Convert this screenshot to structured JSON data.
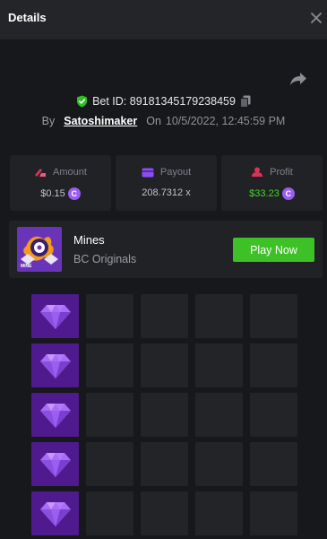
{
  "header": {
    "title": "Details"
  },
  "bet": {
    "id_text": "Bet ID: 89181345179238459",
    "by_label": "By",
    "username": "Satoshimaker",
    "on_label": "On",
    "timestamp": "10/5/2022, 12:45:59 PM"
  },
  "stats": {
    "amount": {
      "label": "Amount",
      "value": "$0.15"
    },
    "payout": {
      "label": "Payout",
      "value": "208.7312 x"
    },
    "profit": {
      "label": "Profit",
      "value": "$33.23"
    }
  },
  "game": {
    "name": "Mines",
    "provider": "BC Originals",
    "thumb_label": "MINE",
    "play_label": "Play Now"
  },
  "board": {
    "columns": 5,
    "rows": [
      [
        "gem",
        "hidden",
        "hidden",
        "hidden",
        "hidden"
      ],
      [
        "gem",
        "hidden",
        "hidden",
        "hidden",
        "hidden"
      ],
      [
        "gem",
        "hidden",
        "hidden",
        "hidden",
        "hidden"
      ],
      [
        "gem",
        "hidden",
        "hidden",
        "hidden",
        "hidden"
      ],
      [
        "gem",
        "hidden",
        "hidden",
        "hidden",
        "hidden"
      ]
    ]
  },
  "colors": {
    "background": "#17181b",
    "header": "#232529",
    "card": "#202226",
    "accent_green": "#3ec126",
    "profit_green": "#48d32a",
    "gem_tile": "#4f1a8e",
    "coin": "#9b5cf2"
  },
  "icons": {
    "close": "close-icon",
    "share": "share-icon",
    "verified": "shield-check-icon",
    "copy": "copy-icon",
    "amount": "bet-amount-icon",
    "payout": "payout-card-icon",
    "profit": "profit-icon",
    "coin": "bc-coin-icon",
    "gem": "diamond-icon"
  }
}
